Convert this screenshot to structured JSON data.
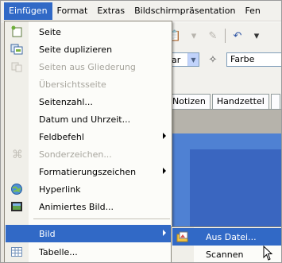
{
  "menubar": {
    "items": [
      {
        "label": "Einfügen",
        "active": true
      },
      {
        "label": "Format"
      },
      {
        "label": "Extras"
      },
      {
        "label": "Bildschirmpräsentation"
      },
      {
        "label": "Fen"
      }
    ]
  },
  "toolbar": {
    "combo_value": "ar",
    "color_label": "Farbe"
  },
  "view_tabs": [
    "Notizen",
    "Handzettel"
  ],
  "menu": {
    "items": [
      {
        "label": "Seite",
        "icon": "new-slide-icon",
        "enabled": true
      },
      {
        "label": "Seite duplizieren",
        "icon": "duplicate-slide-icon",
        "enabled": true
      },
      {
        "label": "Seiten aus Gliederung",
        "icon": "outline-icon",
        "enabled": false
      },
      {
        "label": "Übersichtsseite",
        "enabled": false
      },
      {
        "label": "Seitenzahl...",
        "enabled": true
      },
      {
        "label": "Datum und Uhrzeit...",
        "enabled": true
      },
      {
        "label": "Feldbefehl",
        "enabled": true,
        "submenu": true
      },
      {
        "label": "Sonderzeichen...",
        "icon": "special-character-icon",
        "enabled": false
      },
      {
        "label": "Formatierungszeichen",
        "enabled": true,
        "submenu": true
      },
      {
        "label": "Hyperlink",
        "icon": "hyperlink-icon",
        "enabled": true
      },
      {
        "label": "Animiertes Bild...",
        "icon": "animated-image-icon",
        "enabled": true
      },
      {
        "label": "Bild",
        "enabled": true,
        "submenu": true,
        "highlighted": true
      },
      {
        "label": "Tabelle...",
        "icon": "table-icon",
        "enabled": true
      }
    ]
  },
  "submenu": {
    "items": [
      {
        "label": "Aus Datei...",
        "icon": "from-file-icon",
        "highlighted": true
      },
      {
        "label": "Scannen"
      }
    ]
  }
}
